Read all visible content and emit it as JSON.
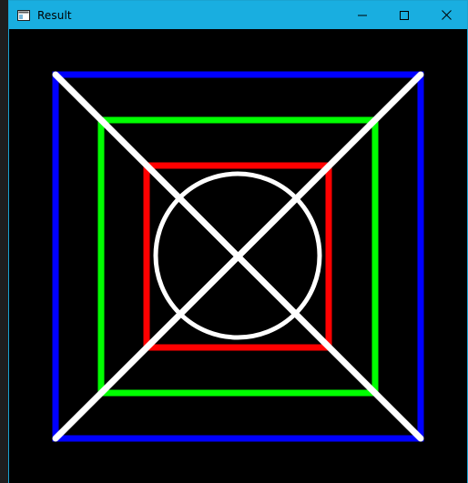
{
  "window": {
    "title": "Result",
    "title_bar_color": "#19aee0"
  },
  "controls": {
    "minimize_icon": "minimize-icon",
    "maximize_icon": "maximize-icon",
    "close_icon": "close-icon"
  },
  "drawing": {
    "background": "#000000",
    "shapes": [
      {
        "kind": "square",
        "color": "#0000ff",
        "name": "outer-blue-square"
      },
      {
        "kind": "square",
        "color": "#00ff00",
        "name": "middle-green-square"
      },
      {
        "kind": "square",
        "color": "#ff0000",
        "name": "inner-red-square"
      },
      {
        "kind": "circle",
        "color": "#ffffff",
        "name": "center-white-circle"
      },
      {
        "kind": "line",
        "color": "#ffffff",
        "name": "diagonal-line-1"
      },
      {
        "kind": "line",
        "color": "#ffffff",
        "name": "diagonal-line-2"
      }
    ]
  }
}
